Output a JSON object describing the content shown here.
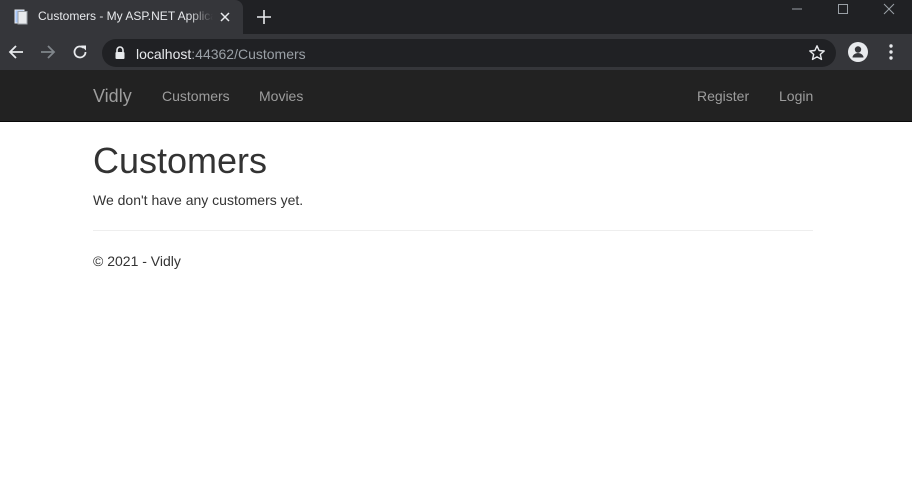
{
  "browser": {
    "tab_title": "Customers - My ASP.NET Application",
    "url_host": "localhost",
    "url_rest": ":44362/Customers"
  },
  "navbar": {
    "brand": "Vidly",
    "left_links": [
      "Customers",
      "Movies"
    ],
    "right_links": [
      "Register",
      "Login"
    ]
  },
  "main": {
    "title": "Customers",
    "message": "We don't have any customers yet."
  },
  "footer": {
    "text": "© 2021 - Vidly"
  },
  "colors": {
    "navbar_bg": "#222222",
    "navbar_link": "#9d9d9d",
    "text": "#333333",
    "chrome_dark": "#202124",
    "chrome_tab": "#35363a"
  },
  "icons": [
    "page-icon",
    "close-icon",
    "plus-icon",
    "minimize-icon",
    "maximize-icon",
    "close-window-icon",
    "back-arrow-icon",
    "forward-arrow-icon",
    "reload-icon",
    "lock-icon",
    "star-icon",
    "profile-icon",
    "kebab-menu-icon"
  ]
}
